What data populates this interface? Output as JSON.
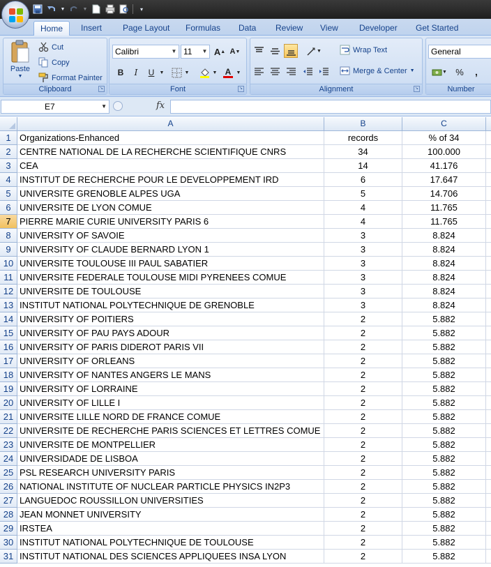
{
  "ribbon": {
    "tabs": [
      "Home",
      "Insert",
      "Page Layout",
      "Formulas",
      "Data",
      "Review",
      "View",
      "Developer",
      "Get Started"
    ],
    "active_tab": "Home",
    "clipboard": {
      "paste": "Paste",
      "cut": "Cut",
      "copy": "Copy",
      "format_painter": "Format Painter",
      "label": "Clipboard"
    },
    "font": {
      "name": "Calibri",
      "size": "11",
      "label": "Font",
      "bold": "B",
      "italic": "I",
      "underline": "U",
      "grow": "A",
      "shrink": "A",
      "font_color_glyph": "A"
    },
    "alignment": {
      "wrap_text": "Wrap Text",
      "merge_center": "Merge & Center",
      "label": "Alignment"
    },
    "number": {
      "format": "General",
      "label": "Number",
      "percent": "%",
      "comma": ","
    }
  },
  "formula_bar": {
    "name_box": "E7",
    "fx": "fx",
    "formula": ""
  },
  "colors": {
    "selected_row_header": "#f1c15f",
    "ribbon_bg": "#c8daf2"
  },
  "grid": {
    "columns": [
      "A",
      "B",
      "C"
    ],
    "selected_row": 7,
    "rows": [
      {
        "n": "1",
        "a": "Organizations-Enhanced",
        "b": "records",
        "c": "% of 34"
      },
      {
        "n": "2",
        "a": "CENTRE NATIONAL DE LA RECHERCHE SCIENTIFIQUE CNRS",
        "b": "34",
        "c": "100.000"
      },
      {
        "n": "3",
        "a": "CEA",
        "b": "14",
        "c": "41.176"
      },
      {
        "n": "4",
        "a": "INSTITUT DE RECHERCHE POUR LE DEVELOPPEMENT IRD",
        "b": "6",
        "c": "17.647"
      },
      {
        "n": "5",
        "a": "UNIVERSITE GRENOBLE ALPES UGA",
        "b": "5",
        "c": "14.706"
      },
      {
        "n": "6",
        "a": "UNIVERSITE DE LYON COMUE",
        "b": "4",
        "c": "11.765"
      },
      {
        "n": "7",
        "a": "PIERRE MARIE CURIE UNIVERSITY PARIS 6",
        "b": "4",
        "c": "11.765"
      },
      {
        "n": "8",
        "a": "UNIVERSITY OF SAVOIE",
        "b": "3",
        "c": "8.824"
      },
      {
        "n": "9",
        "a": "UNIVERSITY OF CLAUDE BERNARD LYON 1",
        "b": "3",
        "c": "8.824"
      },
      {
        "n": "10",
        "a": "UNIVERSITE TOULOUSE III PAUL SABATIER",
        "b": "3",
        "c": "8.824"
      },
      {
        "n": "11",
        "a": "UNIVERSITE FEDERALE TOULOUSE MIDI PYRENEES COMUE",
        "b": "3",
        "c": "8.824"
      },
      {
        "n": "12",
        "a": "UNIVERSITE DE TOULOUSE",
        "b": "3",
        "c": "8.824"
      },
      {
        "n": "13",
        "a": "INSTITUT NATIONAL POLYTECHNIQUE DE GRENOBLE",
        "b": "3",
        "c": "8.824"
      },
      {
        "n": "14",
        "a": "UNIVERSITY OF POITIERS",
        "b": "2",
        "c": "5.882"
      },
      {
        "n": "15",
        "a": "UNIVERSITY OF PAU PAYS ADOUR",
        "b": "2",
        "c": "5.882"
      },
      {
        "n": "16",
        "a": "UNIVERSITY OF PARIS DIDEROT PARIS VII",
        "b": "2",
        "c": "5.882"
      },
      {
        "n": "17",
        "a": "UNIVERSITY OF ORLEANS",
        "b": "2",
        "c": "5.882"
      },
      {
        "n": "18",
        "a": "UNIVERSITY OF NANTES ANGERS LE MANS",
        "b": "2",
        "c": "5.882"
      },
      {
        "n": "19",
        "a": "UNIVERSITY OF LORRAINE",
        "b": "2",
        "c": "5.882"
      },
      {
        "n": "20",
        "a": "UNIVERSITY OF LILLE I",
        "b": "2",
        "c": "5.882"
      },
      {
        "n": "21",
        "a": "UNIVERSITE LILLE NORD DE FRANCE COMUE",
        "b": "2",
        "c": "5.882"
      },
      {
        "n": "22",
        "a": "UNIVERSITE DE RECHERCHE PARIS SCIENCES ET LETTRES COMUE",
        "b": "2",
        "c": "5.882"
      },
      {
        "n": "23",
        "a": "UNIVERSITE DE MONTPELLIER",
        "b": "2",
        "c": "5.882"
      },
      {
        "n": "24",
        "a": "UNIVERSIDADE DE LISBOA",
        "b": "2",
        "c": "5.882"
      },
      {
        "n": "25",
        "a": "PSL RESEARCH UNIVERSITY PARIS",
        "b": "2",
        "c": "5.882"
      },
      {
        "n": "26",
        "a": "NATIONAL INSTITUTE OF NUCLEAR PARTICLE PHYSICS IN2P3",
        "b": "2",
        "c": "5.882"
      },
      {
        "n": "27",
        "a": "LANGUEDOC ROUSSILLON UNIVERSITIES",
        "b": "2",
        "c": "5.882"
      },
      {
        "n": "28",
        "a": "JEAN MONNET UNIVERSITY",
        "b": "2",
        "c": "5.882"
      },
      {
        "n": "29",
        "a": "IRSTEA",
        "b": "2",
        "c": "5.882"
      },
      {
        "n": "30",
        "a": "INSTITUT NATIONAL POLYTECHNIQUE DE TOULOUSE",
        "b": "2",
        "c": "5.882"
      },
      {
        "n": "31",
        "a": "INSTITUT NATIONAL DES SCIENCES APPLIQUEES INSA LYON",
        "b": "2",
        "c": "5.882"
      }
    ]
  }
}
